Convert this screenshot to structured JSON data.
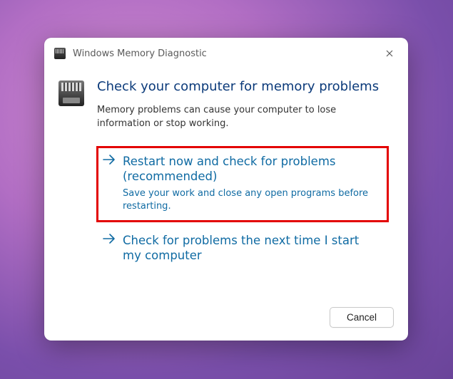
{
  "window": {
    "title": "Windows Memory Diagnostic"
  },
  "heading": "Check your computer for memory problems",
  "description": "Memory problems can cause your computer to lose information or stop working.",
  "options": [
    {
      "title": "Restart now and check for problems (recommended)",
      "subtitle": "Save your work and close any open programs before restarting."
    },
    {
      "title": "Check for problems the next time I start my computer",
      "subtitle": ""
    }
  ],
  "footer": {
    "cancel": "Cancel"
  }
}
